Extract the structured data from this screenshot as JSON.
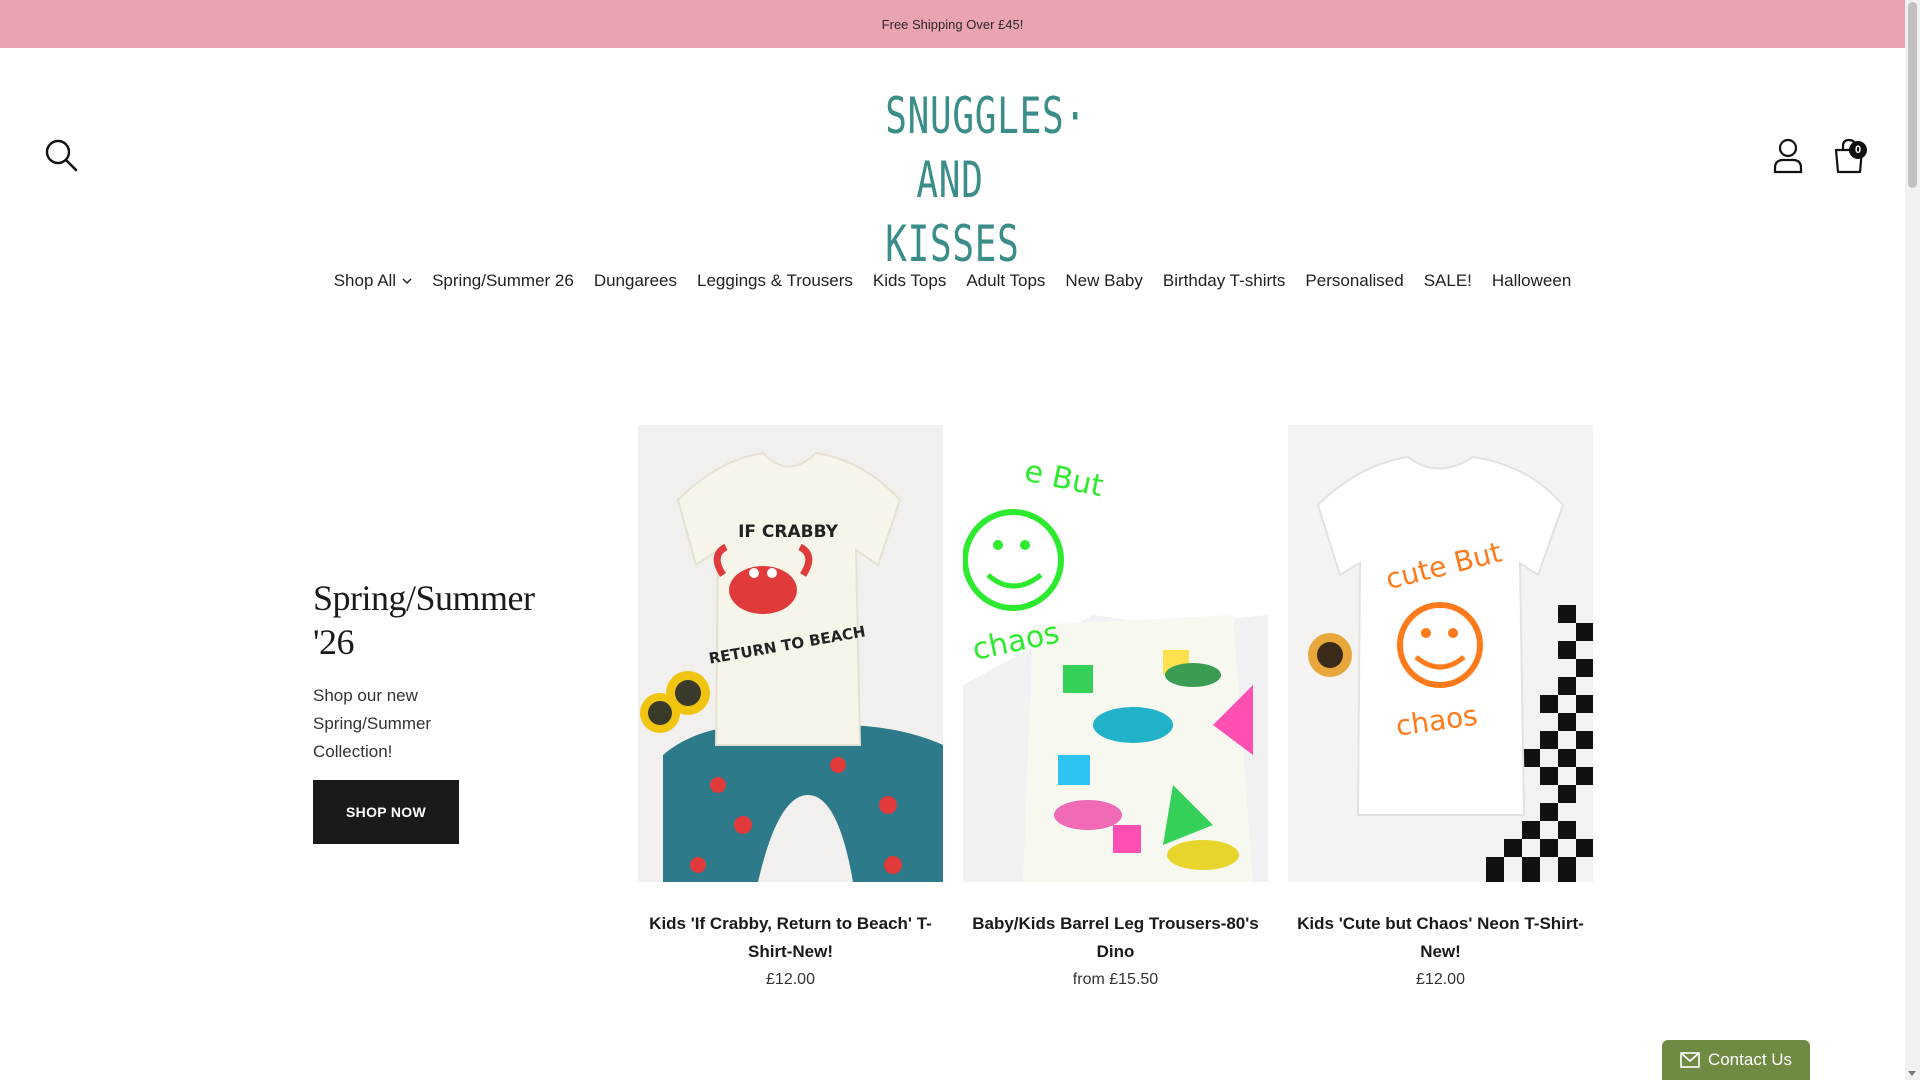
{
  "announcement": "Free Shipping Over £45!",
  "logo": {
    "line1": "SNUGGLES·",
    "line2": "AND KISSES",
    "color": "#3b8d89"
  },
  "header": {
    "cart_count": "0"
  },
  "nav": {
    "items": [
      "Shop All",
      "Spring/Summer 26",
      "Dungarees",
      "Leggings & Trousers",
      "Kids Tops",
      "Adult Tops",
      "New Baby",
      "Birthday T-shirts",
      "Personalised",
      "SALE!",
      "Halloween"
    ]
  },
  "promo": {
    "title": "Spring/Summer '26",
    "text": "Shop our new Spring/Summer Collection!",
    "button": "SHOP NOW"
  },
  "products": [
    {
      "title": "Kids 'If Crabby, Return to Beach' T-Shirt-New!",
      "price": "£12.00",
      "print": [
        "IF CRABBY",
        "RETURN TO BEACH"
      ]
    },
    {
      "title": "Baby/Kids Barrel Leg Trousers-80's Dino",
      "price": "from £15.50",
      "print": [
        "e But",
        "chaos"
      ]
    },
    {
      "title": "Kids 'Cute but Chaos' Neon T-Shirt-New!",
      "price": "£12.00",
      "print": [
        "cute But",
        "chaos"
      ]
    }
  ],
  "contact": {
    "label": "Contact Us"
  },
  "colors": {
    "announcement_bg": "#eaa3b1",
    "contact_bg": "#6f8a42",
    "button_bg": "#1a1a1a"
  }
}
